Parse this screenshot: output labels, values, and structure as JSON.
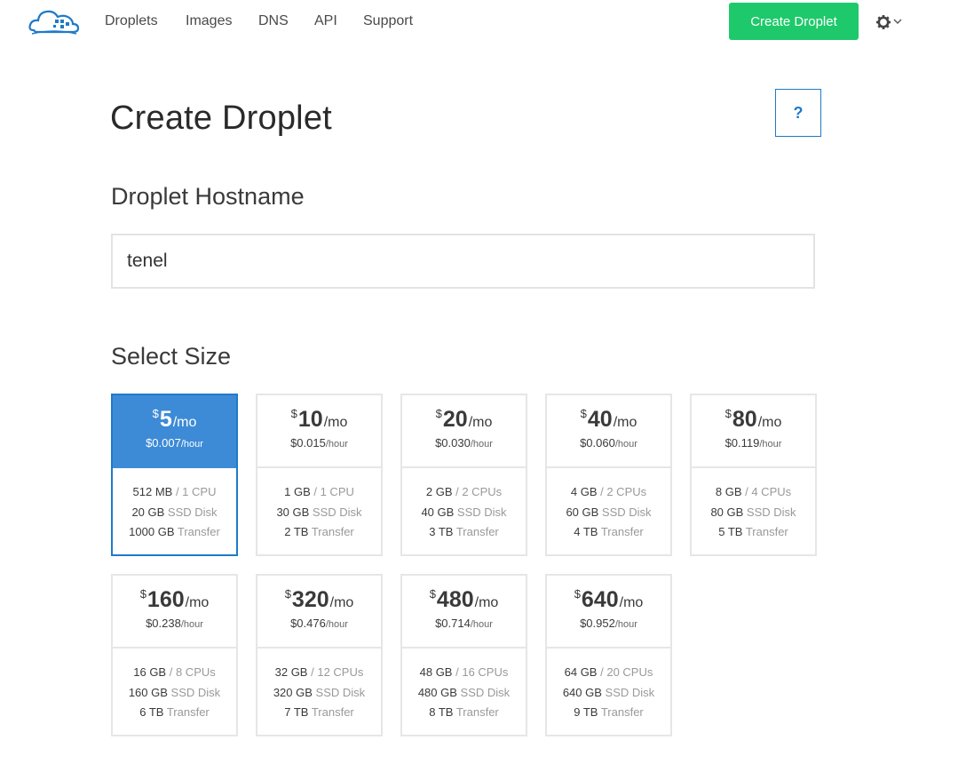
{
  "nav": {
    "links": [
      "Droplets",
      "Images",
      "DNS",
      "API",
      "Support"
    ],
    "create_button": "Create Droplet"
  },
  "page": {
    "title": "Create Droplet",
    "help_label": "?"
  },
  "hostname": {
    "heading": "Droplet Hostname",
    "value": "tenel"
  },
  "size": {
    "heading": "Select Size",
    "selected_index": 0,
    "plans": [
      {
        "currency": "$",
        "monthly": "5",
        "per": "/mo",
        "hourly": "$0.007",
        "hour_unit": "/hour",
        "ram": "512 MB",
        "cpu": "/ 1 CPU",
        "disk": "20 GB",
        "disk_label": "SSD Disk",
        "transfer": "1000 GB",
        "transfer_label": "Transfer"
      },
      {
        "currency": "$",
        "monthly": "10",
        "per": "/mo",
        "hourly": "$0.015",
        "hour_unit": "/hour",
        "ram": "1 GB",
        "cpu": "/ 1 CPU",
        "disk": "30 GB",
        "disk_label": "SSD Disk",
        "transfer": "2 TB",
        "transfer_label": "Transfer"
      },
      {
        "currency": "$",
        "monthly": "20",
        "per": "/mo",
        "hourly": "$0.030",
        "hour_unit": "/hour",
        "ram": "2 GB",
        "cpu": "/ 2 CPUs",
        "disk": "40 GB",
        "disk_label": "SSD Disk",
        "transfer": "3 TB",
        "transfer_label": "Transfer"
      },
      {
        "currency": "$",
        "monthly": "40",
        "per": "/mo",
        "hourly": "$0.060",
        "hour_unit": "/hour",
        "ram": "4 GB",
        "cpu": "/ 2 CPUs",
        "disk": "60 GB",
        "disk_label": "SSD Disk",
        "transfer": "4 TB",
        "transfer_label": "Transfer"
      },
      {
        "currency": "$",
        "monthly": "80",
        "per": "/mo",
        "hourly": "$0.119",
        "hour_unit": "/hour",
        "ram": "8 GB",
        "cpu": "/ 4 CPUs",
        "disk": "80 GB",
        "disk_label": "SSD Disk",
        "transfer": "5 TB",
        "transfer_label": "Transfer"
      },
      {
        "currency": "$",
        "monthly": "160",
        "per": "/mo",
        "hourly": "$0.238",
        "hour_unit": "/hour",
        "ram": "16 GB",
        "cpu": "/ 8 CPUs",
        "disk": "160 GB",
        "disk_label": "SSD Disk",
        "transfer": "6 TB",
        "transfer_label": "Transfer"
      },
      {
        "currency": "$",
        "monthly": "320",
        "per": "/mo",
        "hourly": "$0.476",
        "hour_unit": "/hour",
        "ram": "32 GB",
        "cpu": "/ 12 CPUs",
        "disk": "320 GB",
        "disk_label": "SSD Disk",
        "transfer": "7 TB",
        "transfer_label": "Transfer"
      },
      {
        "currency": "$",
        "monthly": "480",
        "per": "/mo",
        "hourly": "$0.714",
        "hour_unit": "/hour",
        "ram": "48 GB",
        "cpu": "/ 16 CPUs",
        "disk": "480 GB",
        "disk_label": "SSD Disk",
        "transfer": "8 TB",
        "transfer_label": "Transfer"
      },
      {
        "currency": "$",
        "monthly": "640",
        "per": "/mo",
        "hourly": "$0.952",
        "hour_unit": "/hour",
        "ram": "64 GB",
        "cpu": "/ 20 CPUs",
        "disk": "640 GB",
        "disk_label": "SSD Disk",
        "transfer": "9 TB",
        "transfer_label": "Transfer"
      }
    ]
  },
  "icons": {
    "logo": "digitalocean-cloud-logo",
    "settings": "gear-icon"
  },
  "colors": {
    "accent_green": "#1ec96b",
    "accent_blue": "#1f7ac9",
    "selected_fill": "#3d8bd6"
  }
}
